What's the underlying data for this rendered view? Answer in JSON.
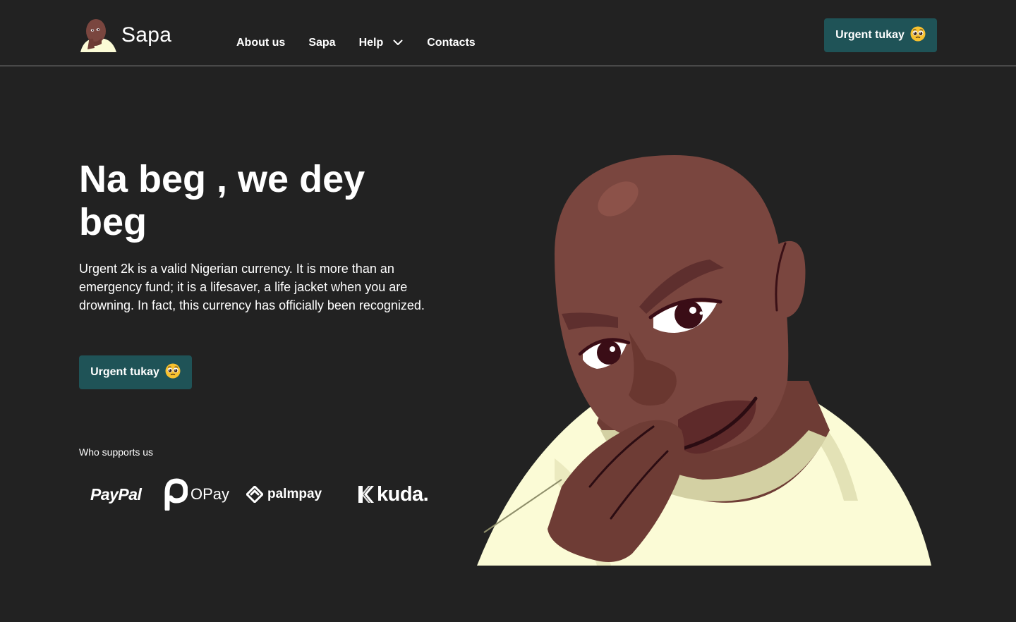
{
  "header": {
    "logo_text": "Sapa",
    "logo_icon": "thinking-man-avatar",
    "nav": [
      {
        "label": "About us"
      },
      {
        "label": "Sapa"
      },
      {
        "label": "Help",
        "icon": "chevron-down-icon"
      },
      {
        "label": "Contacts"
      }
    ],
    "cta_label": "Urgent tukay",
    "cta_emoji": "pleading-face-emoji"
  },
  "hero": {
    "title": "Na beg , we dey beg",
    "description": "Urgent 2k is a valid Nigerian currency. It is more than an emergency fund; it is a lifesaver, a life jacket when you are drowning. In fact, this currency has officially been recognized.",
    "cta_label": "Urgent tukay",
    "cta_emoji": "pleading-face-emoji",
    "illustration": "thinking-man-hand-on-chin"
  },
  "supporters": {
    "label": "Who supports us",
    "brands": [
      "PayPal",
      "OPay",
      "palmpay",
      "kuda."
    ]
  },
  "colors": {
    "background": "#222222",
    "button": "#1f5357",
    "skin": "#7a463f",
    "shirt": "#fbfbd6"
  }
}
